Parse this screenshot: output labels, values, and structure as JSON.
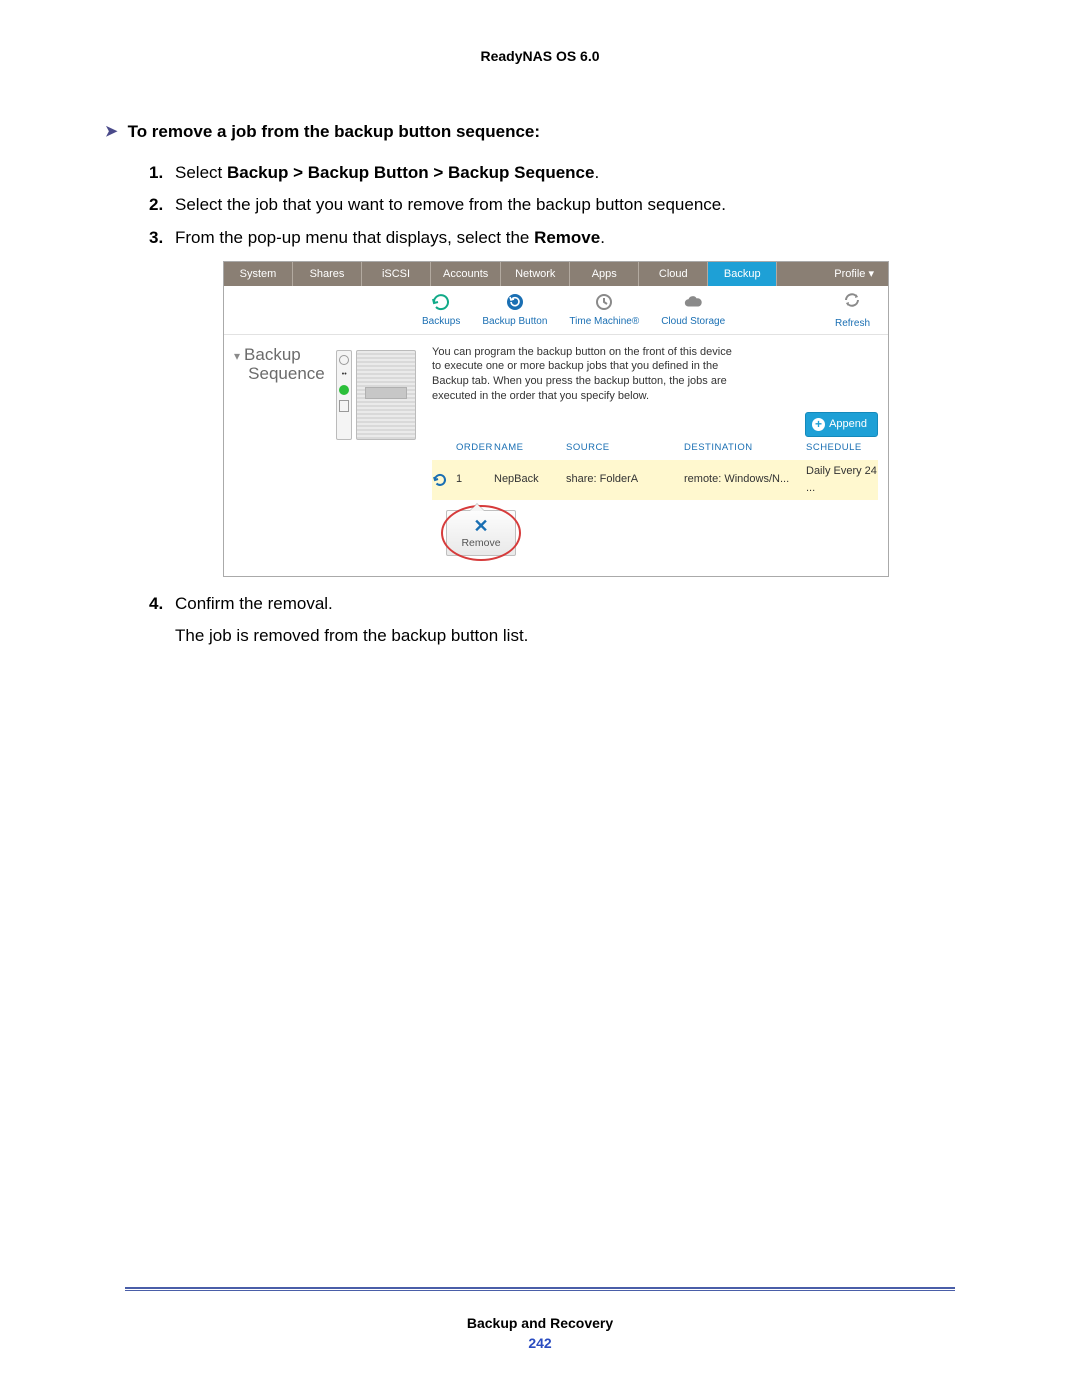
{
  "doc": {
    "header": "ReadyNAS OS 6.0",
    "footer_title": "Backup and Recovery",
    "page_number": "242"
  },
  "section": {
    "heading": "To remove a job from the backup button sequence:",
    "steps": [
      {
        "pre": "Select ",
        "bold": "Backup > Backup Button > Backup Sequence",
        "post": "."
      },
      {
        "text": "Select the job that you want to remove from the backup button sequence."
      },
      {
        "pre": "From the pop-up menu that displays, select the ",
        "bold": "Remove",
        "post": "."
      },
      {
        "text": "Confirm the removal.",
        "follow": "The job is removed from the backup button list."
      }
    ]
  },
  "ui": {
    "topnav": {
      "tabs": [
        "System",
        "Shares",
        "iSCSI",
        "Accounts",
        "Network",
        "Apps",
        "Cloud",
        "Backup"
      ],
      "active": "Backup",
      "profile": "Profile ▾"
    },
    "subnav": {
      "items": [
        {
          "label": "Backups",
          "icon": "backups-icon"
        },
        {
          "label": "Backup Button",
          "icon": "backup-button-icon"
        },
        {
          "label": "Time Machine®",
          "icon": "timemachine-icon"
        },
        {
          "label": "Cloud Storage",
          "icon": "cloud-icon"
        }
      ],
      "refresh": "Refresh"
    },
    "left": {
      "title_line1": "Backup",
      "title_line2": "Sequence"
    },
    "main": {
      "description": "You can program the backup button on the front of this device to execute one or more backup jobs that you defined in the Backup tab. When you press the backup button, the jobs are executed in the order that you specify below.",
      "append_label": "Append",
      "columns": {
        "order": "ORDER",
        "name": "NAME",
        "source": "SOURCE",
        "destination": "DESTINATION",
        "schedule": "SCHEDULE"
      },
      "rows": [
        {
          "order": "1",
          "name": "NepBack",
          "source": "share: FolderA",
          "destination": "remote: Windows/N...",
          "schedule": "Daily Every 24 ..."
        }
      ],
      "popup_label": "Remove"
    }
  }
}
